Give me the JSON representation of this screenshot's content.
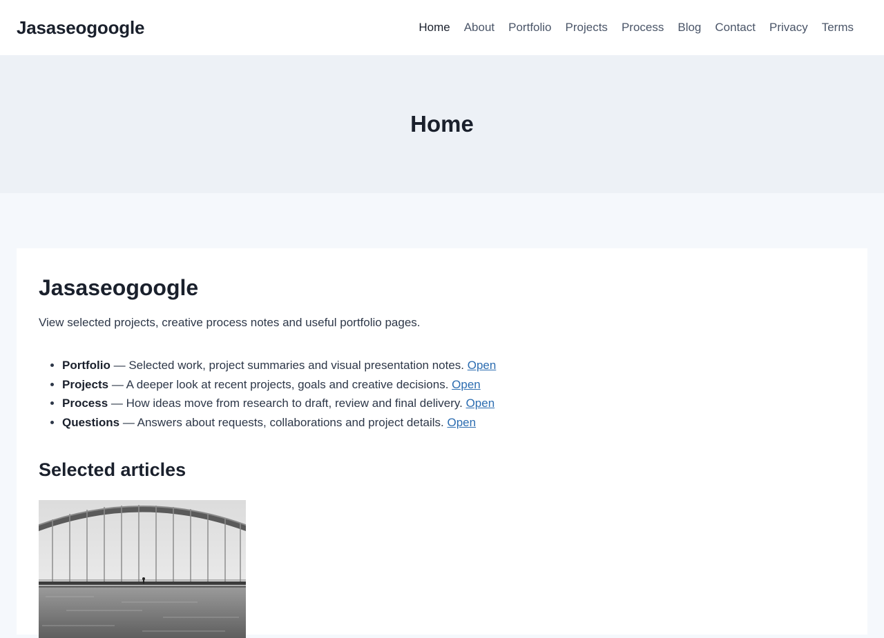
{
  "site": {
    "title": "Jasaseogoogle"
  },
  "nav": {
    "items": [
      {
        "label": "Home",
        "active": true
      },
      {
        "label": "About"
      },
      {
        "label": "Portfolio"
      },
      {
        "label": "Projects"
      },
      {
        "label": "Process"
      },
      {
        "label": "Blog"
      },
      {
        "label": "Contact"
      },
      {
        "label": "Privacy"
      },
      {
        "label": "Terms"
      }
    ]
  },
  "hero": {
    "title": "Home"
  },
  "main": {
    "title": "Jasaseogoogle",
    "intro": "View selected projects, creative process notes and useful portfolio pages.",
    "features": [
      {
        "name": "Portfolio",
        "text": " — Selected work, project summaries and visual presentation notes. ",
        "link": "Open"
      },
      {
        "name": "Projects",
        "text": " — A deeper look at recent projects, goals and creative decisions. ",
        "link": "Open"
      },
      {
        "name": "Process",
        "text": " — How ideas move from research to draft, review and final delivery. ",
        "link": "Open"
      },
      {
        "name": "Questions",
        "text": " — Answers about requests, collaborations and project details. ",
        "link": "Open"
      }
    ],
    "articles_heading": "Selected articles"
  },
  "colors": {
    "accent_link": "#2b6cb0",
    "hero_bg": "#edf1f6",
    "page_bg": "#f5f8fc"
  }
}
